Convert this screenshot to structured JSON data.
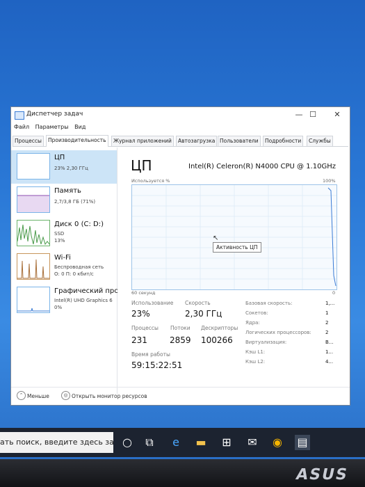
{
  "window": {
    "title": "Диспетчер задач",
    "controls": {
      "minimize": "—",
      "maximize": "☐",
      "close": "✕"
    }
  },
  "menu": [
    "Файл",
    "Параметры",
    "Вид"
  ],
  "tabs": [
    "Процессы",
    "Производительность",
    "Журнал приложений",
    "Автозагрузка",
    "Пользователи",
    "Подробности",
    "Службы"
  ],
  "active_tab": "Производительность",
  "sidebar": {
    "items": [
      {
        "name": "ЦП",
        "lines": [
          "23% 2,30 ГГц"
        ]
      },
      {
        "name": "Память",
        "lines": [
          "2,7/3,8 ГБ (71%)"
        ]
      },
      {
        "name": "Диск 0 (C: D:)",
        "lines": [
          "SSD",
          "13%"
        ]
      },
      {
        "name": "Wi-Fi",
        "lines": [
          "Беспроводная сеть",
          "О: 0 П: 0 кбит/с"
        ]
      },
      {
        "name": "Графический прс",
        "lines": [
          "Intel(R) UHD Graphics 6",
          "0%"
        ]
      }
    ]
  },
  "cpu": {
    "title": "ЦП",
    "model": "Intel(R) Celeron(R) N4000 CPU @ 1.10GHz",
    "graph_label": "Используется %",
    "graph_max": "100%",
    "graph_time": "60 секунд",
    "graph_min": "0",
    "tooltip": "Активность ЦП",
    "usage_fraction": 0.23
  },
  "stats": {
    "usage_label": "Использование",
    "usage_value": "23%",
    "speed_label": "Скорость",
    "speed_value": "2,30 ГГц",
    "proc_label": "Процессы",
    "proc_value": "231",
    "threads_label": "Потоки",
    "threads_value": "2859",
    "handles_label": "Дескрипторы",
    "handles_value": "100266",
    "uptime_label": "Время работы",
    "uptime_value": "59:15:22:51"
  },
  "specs": [
    {
      "label": "Базовая скорость:",
      "value": "1,..."
    },
    {
      "label": "Сокетов:",
      "value": "1"
    },
    {
      "label": "Ядра:",
      "value": "2"
    },
    {
      "label": "Логических процессоров:",
      "value": "2"
    },
    {
      "label": "Виртуализация:",
      "value": "В..."
    },
    {
      "label": "Кэш L1:",
      "value": "1..."
    },
    {
      "label": "Кэш L2:",
      "value": "4..."
    }
  ],
  "footer": {
    "less": "Меньше",
    "monitor": "Открыть монитор ресурсов"
  },
  "taskbar": {
    "search_placeholder": "ать поиск, введите здесь запрос"
  },
  "brand": "ASUS",
  "colors": {
    "accent": "#0b6fc7",
    "selection": "#cce4f7",
    "graph_border": "#9cc3e8"
  }
}
